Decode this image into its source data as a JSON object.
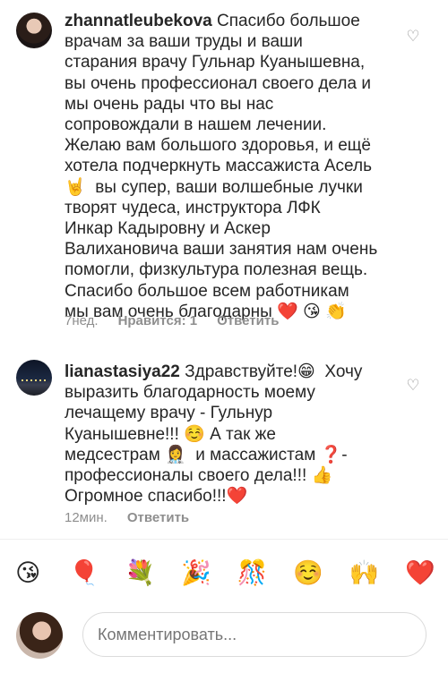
{
  "comments": [
    {
      "username": "zhannatleubekova",
      "text": " Спасибо большое\nврачам за ваши труды и ваши\nстарания врачу Гульнар Куанышевна,\nвы очень профессионал своего дела и\nмы очень рады что вы нас\nсопровождали в нашем лечении.\nЖелаю вам большого здоровья, и ещё\nхотела подчеркнуть массажиста Асель\n🤘  вы супер, ваши волшебные лучки\nтворят чудеса, инструктора ЛФК\nИнкар Кадыровну и Аскер\nВалихановича ваши занятия нам очень\nпомогли, физкультура полезная вещь.\nСпасибо большое всем работникам\nмы вам очень благодарны ❤️ 😘 👏",
      "time": "7нед.",
      "likes": "Нравится: 1",
      "reply": "Ответить"
    },
    {
      "username": "lianastasiya22",
      "text": " Здравствуйте!😁  Хочу\nвыразить благодарность моему\nлечащему врачу - Гульнур\nКуанышевне!!! ☺️ А так же\nмедсестрам 👩‍⚕️  и массажистам ❓-\nпрофессионалы своего дела!!! 👍\nОгромное спасибо!!!❤️",
      "time": "12мин.",
      "reply": "Ответить"
    }
  ],
  "icons": {
    "like": "heart-outline-icon"
  },
  "emoji_bar": [
    "😘",
    "🎈",
    "💐",
    "🎉",
    "🎊",
    "☺️",
    "🙌",
    "❤️"
  ],
  "input": {
    "placeholder": "Комментировать..."
  }
}
